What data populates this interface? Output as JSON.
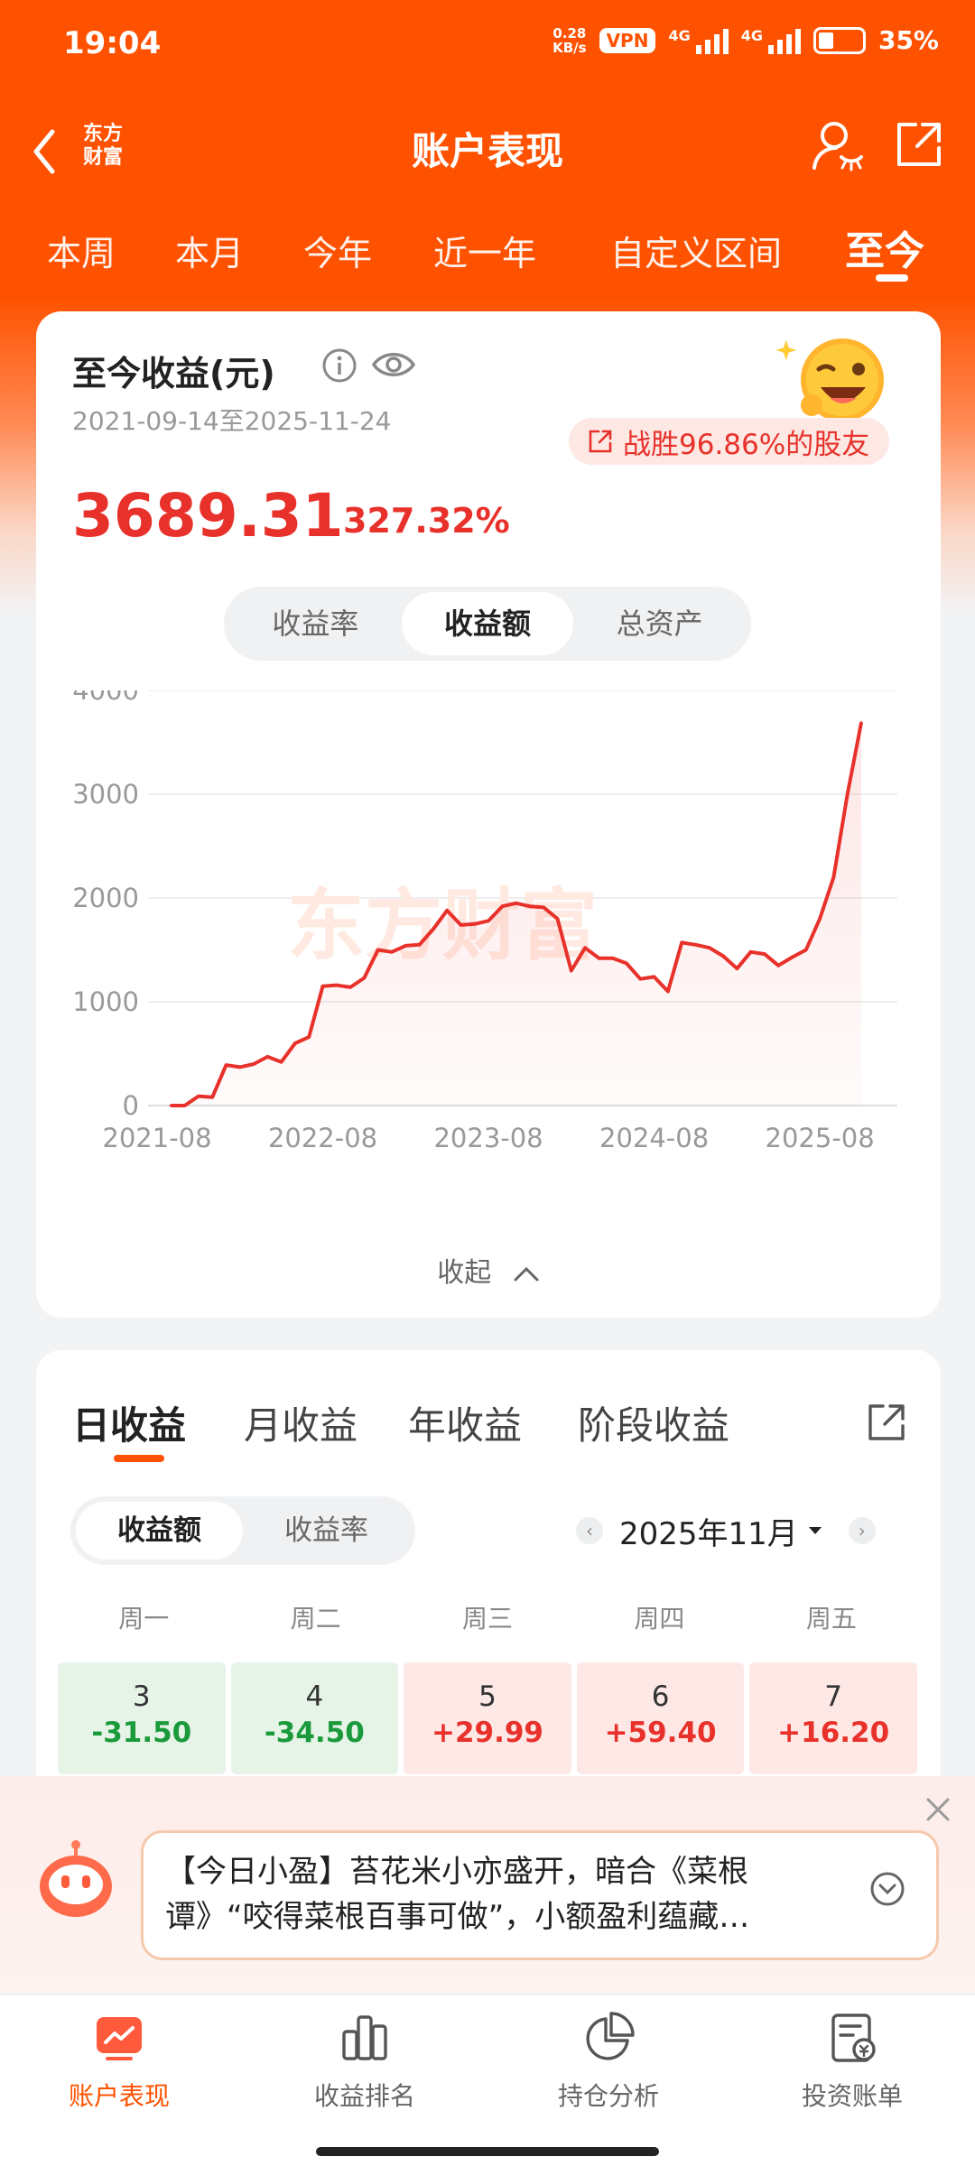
{
  "status_bar": {
    "time": "19:04",
    "net_speed_value": "0.28",
    "net_speed_unit": "KB/s",
    "vpn": "VPN",
    "signal1": "4G",
    "signal2": "4G",
    "battery": "35%"
  },
  "nav": {
    "back_logo_line1": "东方",
    "back_logo_line2": "财富",
    "title": "账户表现"
  },
  "period_tabs": [
    "本周",
    "本月",
    "今年",
    "近一年",
    "自定义区间",
    "至今"
  ],
  "summary": {
    "label": "至今收益(元)",
    "date_range": "2021-09-14至2025-11-24",
    "beat_text": "战胜96.86%的股友",
    "amount": "3689.31",
    "rate": "327.32%"
  },
  "metric_toggle": [
    "收益率",
    "收益额",
    "总资产"
  ],
  "chart_data": {
    "type": "line",
    "watermark": "东方财富",
    "x_tick_labels": [
      "2021-08",
      "2022-08",
      "2023-08",
      "2024-08",
      "2025-08"
    ],
    "y_tick_labels": [
      "4000",
      "3000",
      "2000",
      "1000",
      "0"
    ],
    "ylim": [
      0,
      4000
    ],
    "xlim": [
      "2021-08",
      "2025-11"
    ],
    "x": [
      "2021-09",
      "2021-10",
      "2021-11",
      "2021-12",
      "2022-01",
      "2022-02",
      "2022-03",
      "2022-04",
      "2022-05",
      "2022-06",
      "2022-07",
      "2022-08",
      "2022-09",
      "2022-10",
      "2022-11",
      "2022-12",
      "2023-01",
      "2023-02",
      "2023-03",
      "2023-04",
      "2023-05",
      "2023-06",
      "2023-07",
      "2023-08",
      "2023-09",
      "2023-10",
      "2023-11",
      "2023-12",
      "2024-01",
      "2024-02",
      "2024-03",
      "2024-04",
      "2024-05",
      "2024-06",
      "2024-07",
      "2024-08",
      "2024-09",
      "2024-10",
      "2024-11",
      "2024-12",
      "2025-01",
      "2025-02",
      "2025-03",
      "2025-04",
      "2025-05",
      "2025-06",
      "2025-07",
      "2025-08",
      "2025-09",
      "2025-10",
      "2025-11"
    ],
    "values": [
      0,
      0,
      90,
      80,
      390,
      370,
      400,
      470,
      420,
      600,
      660,
      1150,
      1160,
      1140,
      1230,
      1500,
      1480,
      1540,
      1550,
      1700,
      1880,
      1740,
      1750,
      1780,
      1920,
      1950,
      1920,
      1910,
      1800,
      1300,
      1520,
      1420,
      1420,
      1370,
      1220,
      1240,
      1100,
      1570,
      1550,
      1520,
      1440,
      1320,
      1480,
      1460,
      1350,
      1430,
      1500,
      1800,
      2200,
      3000,
      3689
    ]
  },
  "collapse_label": "收起",
  "profit_tabs": [
    "日收益",
    "月收益",
    "年收益",
    "阶段收益"
  ],
  "profit_toggle": [
    "收益额",
    "收益率"
  ],
  "month_label": "2025年11月",
  "weekdays": [
    "周一",
    "周二",
    "周三",
    "周四",
    "周五"
  ],
  "days": [
    {
      "day": "3",
      "value": "-31.50"
    },
    {
      "day": "4",
      "value": "-34.50"
    },
    {
      "day": "5",
      "value": "+29.99"
    },
    {
      "day": "6",
      "value": "+59.40"
    },
    {
      "day": "7",
      "value": "+16.20"
    }
  ],
  "popup_text": "【今日小盈】苔花米小亦盛开，暗合《菜根谭》“咬得菜根百事可做”，小额盈利蕴藏…",
  "bottom_nav": [
    "账户表现",
    "收益排名",
    "持仓分析",
    "投资账单"
  ],
  "colors": {
    "brand": "#ff5200",
    "gain": "#e8312a",
    "loss": "#1a9a3a"
  }
}
